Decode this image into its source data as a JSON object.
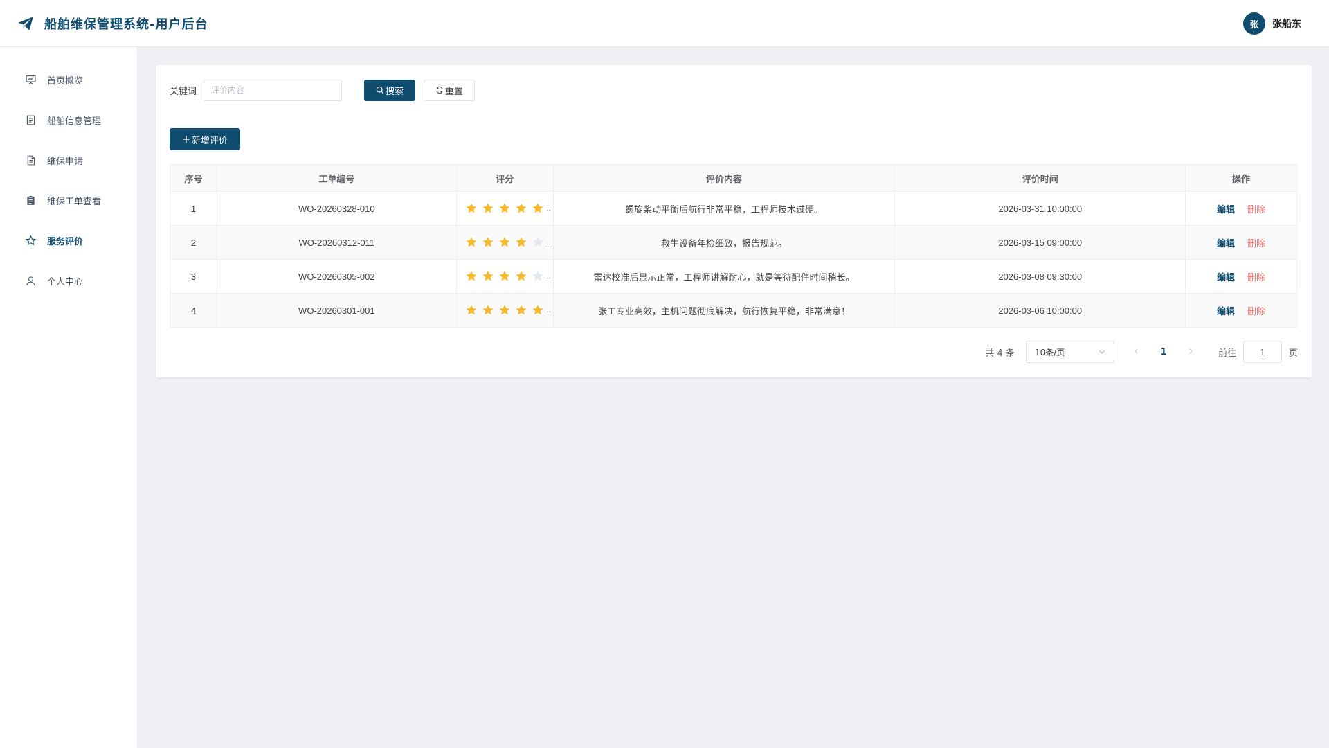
{
  "app": {
    "title": "船舶维保管理系统-用户后台"
  },
  "user": {
    "avatar_text": "张",
    "name": "张船东"
  },
  "sidebar": {
    "items": [
      {
        "label": "首页概览",
        "icon": "presentation-chart-icon",
        "active": false
      },
      {
        "label": "船舶信息管理",
        "icon": "document-icon",
        "active": false
      },
      {
        "label": "维保申请",
        "icon": "file-text-icon",
        "active": false
      },
      {
        "label": "维保工单查看",
        "icon": "clipboard-icon",
        "active": false
      },
      {
        "label": "服务评价",
        "icon": "star-icon",
        "active": true
      },
      {
        "label": "个人中心",
        "icon": "user-icon",
        "active": false
      }
    ]
  },
  "search": {
    "label": "关键词",
    "placeholder": "评价内容",
    "value": "",
    "search_label": "搜索",
    "reset_label": "重置"
  },
  "toolbar": {
    "add_label": "新增评价"
  },
  "table": {
    "headers": [
      "序号",
      "工单编号",
      "评分",
      "评价内容",
      "评价时间",
      "操作"
    ],
    "rows": [
      {
        "index": "1",
        "order": "WO-20260328-010",
        "rating": 5,
        "content": "螺旋桨动平衡后航行非常平稳，工程师技术过硬。",
        "time": "2026-03-31 10:00:00"
      },
      {
        "index": "2",
        "order": "WO-20260312-011",
        "rating": 4,
        "content": "救生设备年检细致，报告规范。",
        "time": "2026-03-15 09:00:00"
      },
      {
        "index": "3",
        "order": "WO-20260305-002",
        "rating": 4,
        "content": "雷达校准后显示正常，工程师讲解耐心，就是等待配件时间稍长。",
        "time": "2026-03-08 09:30:00"
      },
      {
        "index": "4",
        "order": "WO-20260301-001",
        "rating": 5,
        "content": "张工专业高效，主机问题彻底解决，航行恢复平稳，非常满意！",
        "time": "2026-03-06 10:00:00"
      }
    ],
    "edit_label": "编辑",
    "delete_label": "删除",
    "rating_max": 5
  },
  "pagination": {
    "total_text": "共 4 条",
    "page_size": "10条/页",
    "current_page": "1",
    "goto_label": "前往",
    "goto_value": "1",
    "page_suffix": "页"
  },
  "colors": {
    "primary": "#0f4c6e",
    "star": "#f7ba2a",
    "star_empty": "#e4e7ed",
    "danger": "#f56c6c"
  }
}
